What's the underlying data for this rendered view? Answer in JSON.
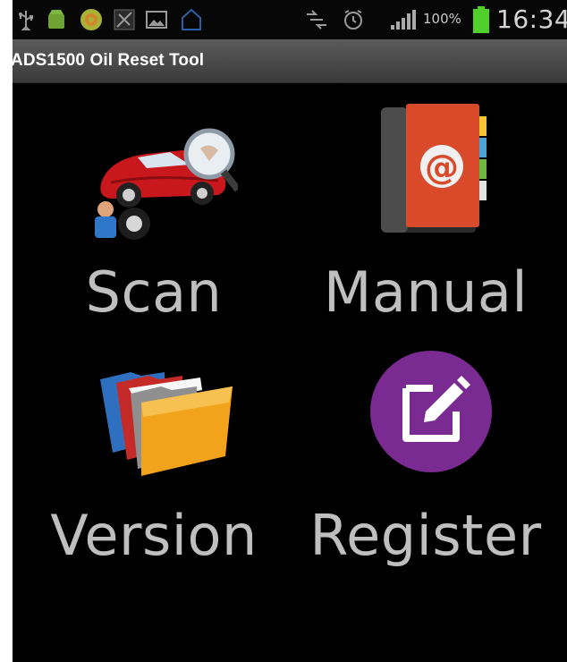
{
  "status_bar": {
    "battery_percent": "100%",
    "time": "16:34",
    "icons": [
      "usb-icon",
      "android-notification-icon",
      "globe-app-icon",
      "signal-muted-icon",
      "image-icon",
      "sync-icon",
      "network-icon",
      "alarm-icon",
      "signal-strength-icon",
      "battery-icon"
    ]
  },
  "app": {
    "title": "ADS1500 Oil Reset Tool"
  },
  "menu": {
    "scan": {
      "label": "Scan",
      "icon": "car-diagnostic-icon"
    },
    "manual": {
      "label": "Manual",
      "icon": "address-book-icon"
    },
    "version": {
      "label": "Version",
      "icon": "folders-icon"
    },
    "register": {
      "label": "Register",
      "icon": "edit-register-icon"
    }
  },
  "colors": {
    "background": "#000000",
    "label": "#bfbfbf",
    "register_circle": "#7a2b91",
    "book_red": "#d84a2c",
    "folder_orange": "#f0a21a"
  }
}
